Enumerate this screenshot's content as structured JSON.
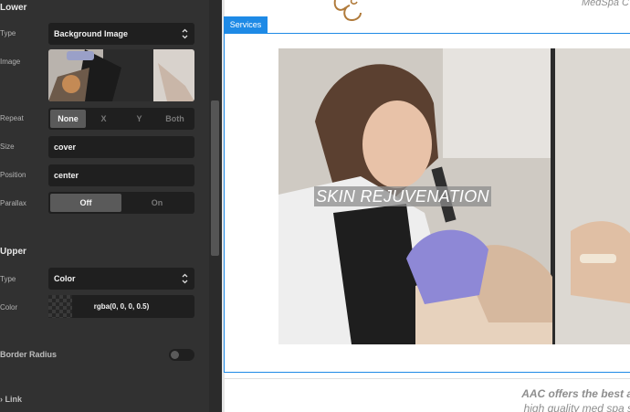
{
  "panel": {
    "lower": {
      "title": "Lower",
      "type_label": "Type",
      "type_value": "Background Image",
      "image_label": "Image",
      "repeat_label": "Repeat",
      "repeat_options": [
        "None",
        "X",
        "Y",
        "Both"
      ],
      "repeat_selected": "None",
      "size_label": "Size",
      "size_value": "cover",
      "position_label": "Position",
      "position_value": "center",
      "parallax_label": "Parallax",
      "parallax_options": [
        "Off",
        "On"
      ],
      "parallax_selected": "Off"
    },
    "upper": {
      "title": "Upper",
      "type_label": "Type",
      "type_value": "Color",
      "color_label": "Color",
      "color_value": "rgba(0, 0, 0, 0.5)"
    },
    "border_radius_label": "Border Radius",
    "border_radius_enabled": false,
    "link_label": "Link"
  },
  "canvas": {
    "brand_text": "MedSpa C",
    "tab_label": "Services",
    "hero_title": "SKIN REJUVENATION",
    "footer_line1": "AAC offers the best a",
    "footer_line2": "high quality med spa s"
  },
  "colors": {
    "accent": "#1e8ae6",
    "panel_bg": "#313131",
    "field_bg": "#1f1f1f"
  }
}
